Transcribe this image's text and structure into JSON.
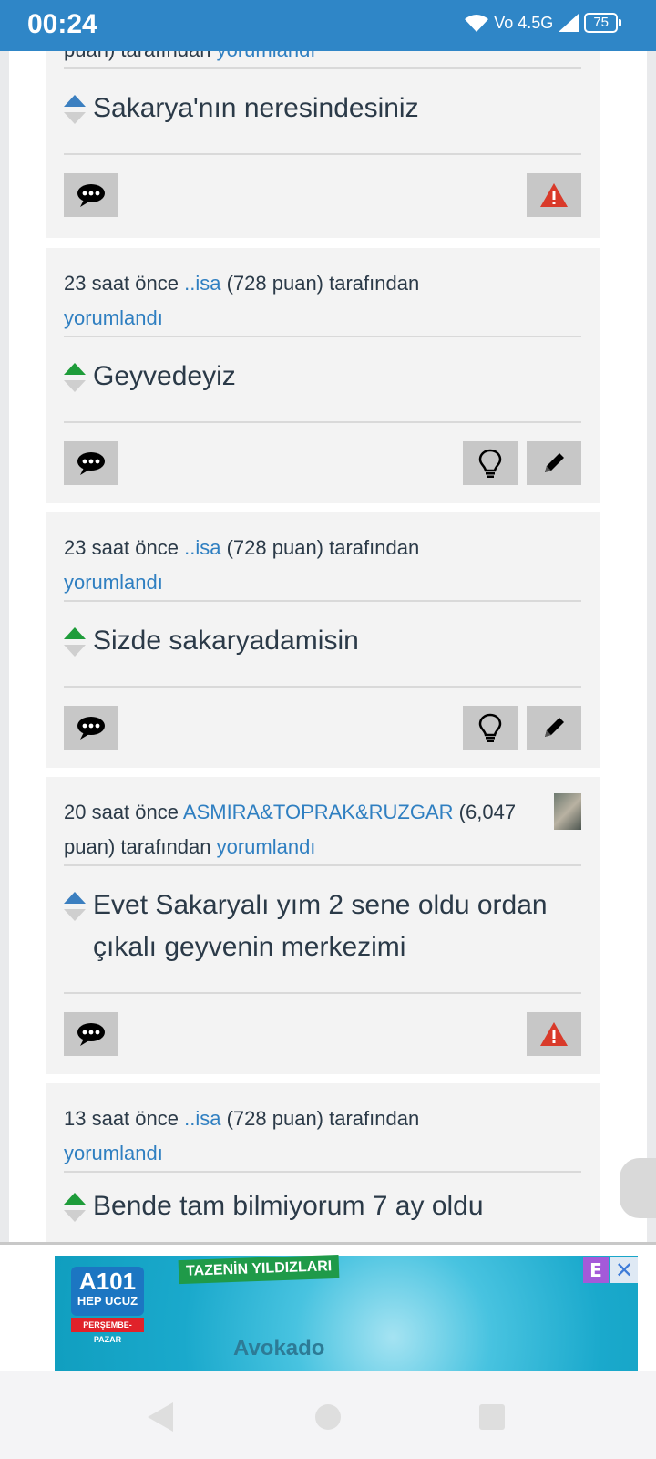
{
  "status_bar": {
    "time": "00:24",
    "network": "Vo 4.5G",
    "battery": "75"
  },
  "comments": [
    {
      "meta_prefix": "",
      "author": "",
      "meta_rest": "puan) tarafından",
      "action": "yorumlandı",
      "text": "Sakarya'nın neresindesiniz",
      "vote_color": "blue",
      "actions": [
        "comment",
        "flag"
      ]
    },
    {
      "meta_prefix": "23 saat önce",
      "author": "..isa",
      "meta_rest": "(728 puan) tarafından",
      "action": "yorumlandı",
      "text": "Geyvedeyiz",
      "vote_color": "green",
      "actions": [
        "comment",
        "best-answer",
        "edit"
      ]
    },
    {
      "meta_prefix": "23 saat önce",
      "author": "..isa",
      "meta_rest": "(728 puan) tarafından",
      "action": "yorumlandı",
      "text": "Sizde sakaryadamisin",
      "vote_color": "green",
      "actions": [
        "comment",
        "best-answer",
        "edit"
      ]
    },
    {
      "meta_prefix": "20 saat önce",
      "author": "ASMIRA&TOPRAK&RUZGAR",
      "meta_rest": "(6,047 puan) tarafından",
      "action": "yorumlandı",
      "text": "Evet Sakaryalı yım 2 sene oldu ordan çıkalı geyvenin merkezimi",
      "vote_color": "blue",
      "actions": [
        "comment",
        "flag"
      ]
    },
    {
      "meta_prefix": "13 saat önce",
      "author": "..isa",
      "meta_rest": "(728 puan) tarafından",
      "action": "yorumlandı",
      "text": "Bende tam bilmiyorum 7 ay oldu",
      "vote_color": "green",
      "actions": []
    }
  ],
  "ad": {
    "brand_logo": "A101",
    "brand_slogan": "HEP UCUZ",
    "brand_days": "PERŞEMBE-PAZAR",
    "banner": "TAZENİN YILDIZLARI",
    "product": "Avokado",
    "badge": "E",
    "close": "✕"
  },
  "icons": {
    "comment": "speech-bubble-icon",
    "flag": "warning-icon",
    "best-answer": "lightbulb-icon",
    "edit": "pencil-icon"
  },
  "colors": {
    "link": "#2f7fc1",
    "status_bar": "#2f86c7",
    "vote_up_blue": "#3b7fc0",
    "vote_up_green": "#1e9c3a",
    "warning_red": "#d93a2a"
  }
}
